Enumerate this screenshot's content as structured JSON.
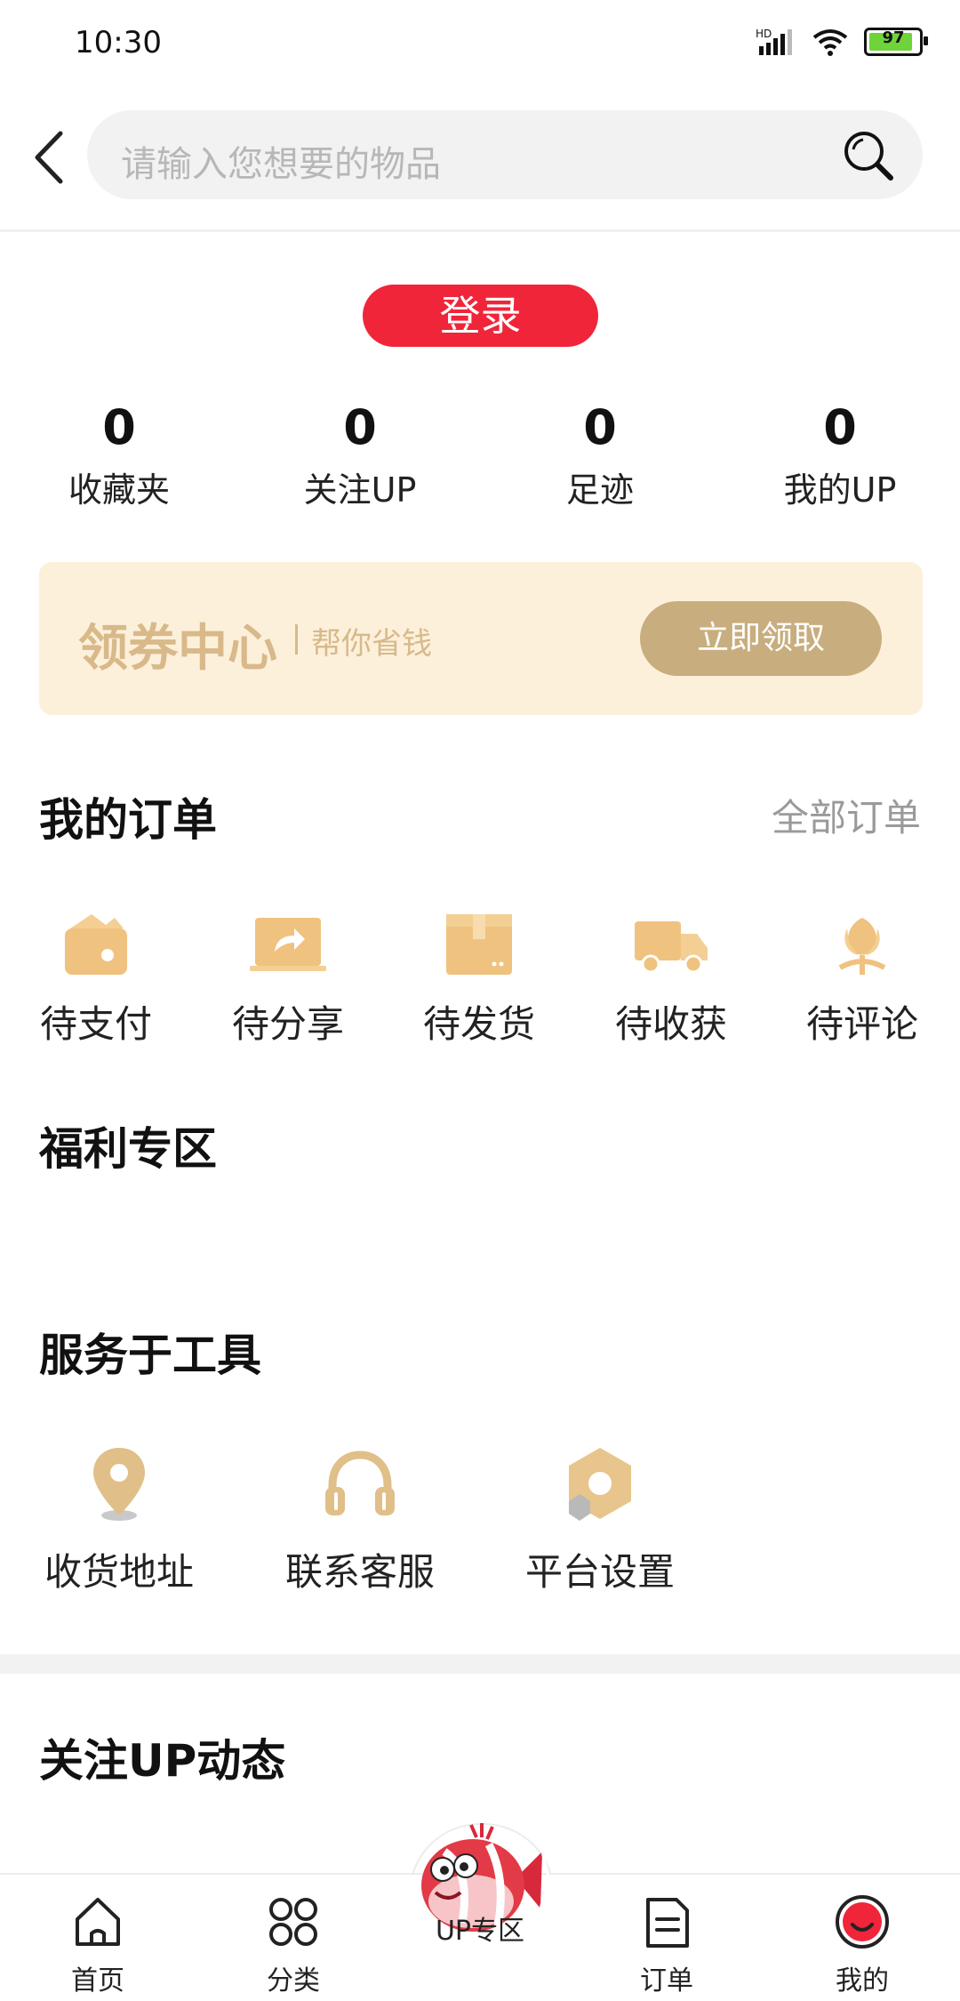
{
  "status_bar": {
    "time": "10:30",
    "battery": "97"
  },
  "search": {
    "placeholder": "请输入您想要的物品"
  },
  "login_label": "登录",
  "stats": [
    {
      "value": "0",
      "label": "收藏夹"
    },
    {
      "value": "0",
      "label": "关注UP"
    },
    {
      "value": "0",
      "label": "足迹"
    },
    {
      "value": "0",
      "label": "我的UP"
    }
  ],
  "coupon": {
    "title": "领券中心",
    "subtitle": "帮你省钱",
    "button": "立即领取"
  },
  "orders": {
    "title": "我的订单",
    "all_link": "全部订单",
    "items": [
      {
        "label": "待支付",
        "icon": "wallet-icon"
      },
      {
        "label": "待分享",
        "icon": "share-icon"
      },
      {
        "label": "待发货",
        "icon": "package-icon"
      },
      {
        "label": "待收获",
        "icon": "truck-icon"
      },
      {
        "label": "待评论",
        "icon": "flower-icon"
      }
    ]
  },
  "welfare_title": "福利专区",
  "tools": {
    "title": "服务于工具",
    "items": [
      {
        "label": "收货地址",
        "icon": "location-pin-icon"
      },
      {
        "label": "联系客服",
        "icon": "headphones-icon"
      },
      {
        "label": "平台设置",
        "icon": "settings-hexagon-icon"
      }
    ]
  },
  "follow_title": "关注UP动态",
  "tabbar": [
    {
      "label": "首页",
      "icon": "home-icon"
    },
    {
      "label": "分类",
      "icon": "category-icon"
    },
    {
      "label": "UP专区",
      "icon": "fish-mascot-icon"
    },
    {
      "label": "订单",
      "icon": "order-doc-icon"
    },
    {
      "label": "我的",
      "icon": "profile-icon"
    }
  ],
  "colors": {
    "accent": "#f0253a",
    "gold": "#d8b98a",
    "coupon_bg": "#fdf0db"
  }
}
